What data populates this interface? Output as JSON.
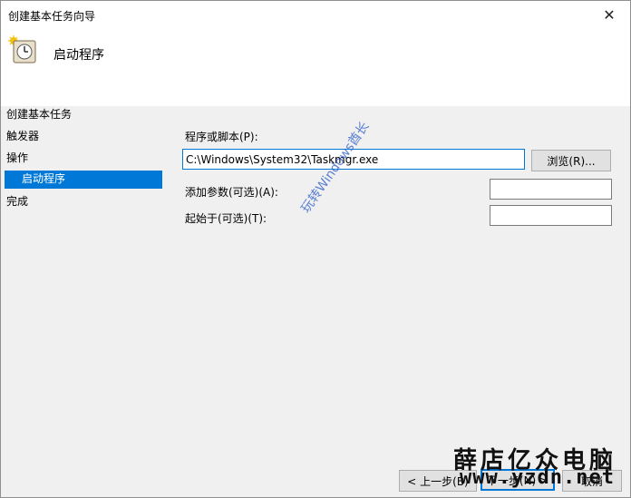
{
  "window": {
    "title": "创建基本任务向导",
    "close_glyph": "✕"
  },
  "header": {
    "heading": "启动程序",
    "icon": "task-scheduler-clock-icon"
  },
  "sidebar": {
    "items": [
      {
        "label": "创建基本任务",
        "active": false
      },
      {
        "label": "触发器",
        "active": false
      },
      {
        "label": "操作",
        "active": false
      },
      {
        "label": "启动程序",
        "active": true
      },
      {
        "label": "完成",
        "active": false
      }
    ]
  },
  "form": {
    "program_label": "程序或脚本(P):",
    "program_value": "C:\\Windows\\System32\\Taskmgr.exe",
    "browse_button": "浏览(R)...",
    "args_label": "添加参数(可选)(A):",
    "args_value": "",
    "start_in_label": "起始于(可选)(T):",
    "start_in_value": ""
  },
  "footer": {
    "back_button": "< 上一步(B)",
    "next_button": "下一步(N) >",
    "cancel_button": "取消"
  },
  "watermark": {
    "text": "玩转Windows酋长"
  },
  "brand": {
    "name": "薛店亿众电脑",
    "url": "www.yzdn.net"
  },
  "colors": {
    "accent": "#0078d7",
    "selected_text": "#ffffff",
    "watermark": "#2f5fc8"
  }
}
